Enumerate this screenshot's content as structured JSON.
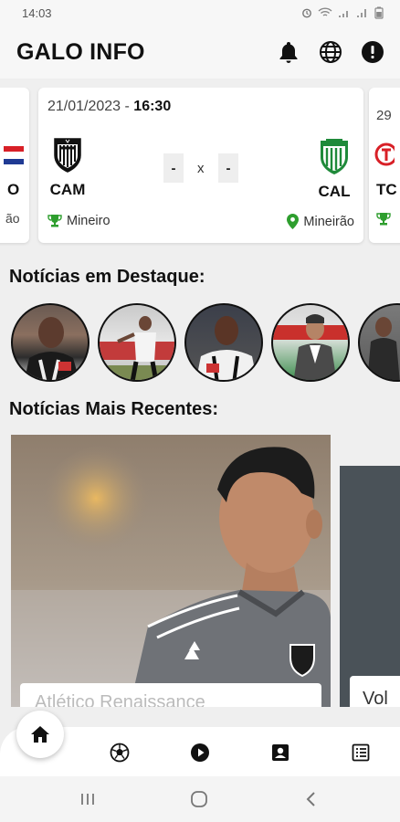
{
  "status_bar": {
    "time": "14:03"
  },
  "header": {
    "title": "GALO INFO"
  },
  "matches": {
    "main": {
      "date": "21/01/2023",
      "separator": " - ",
      "time": "16:30",
      "home_abbr": "CAM",
      "away_abbr": "CAL",
      "home_score": "-",
      "away_score": "-",
      "versus": "x",
      "competition": "Mineiro",
      "venue": "Mineirão"
    },
    "prev": {
      "abbr": "O",
      "venue_fragment": "ão"
    },
    "next": {
      "date_fragment": "29",
      "abbr": "TC"
    }
  },
  "sections": {
    "featured": "Notícias em Destaque:",
    "recent": "Notícias Mais Recentes:"
  },
  "news": {
    "card1_caption": "Atlético Renaissance",
    "card2_caption": "Vol"
  },
  "colors": {
    "green_accent": "#2e9e2e",
    "brand_black": "#111111",
    "caldense_green": "#1f8a3a"
  }
}
